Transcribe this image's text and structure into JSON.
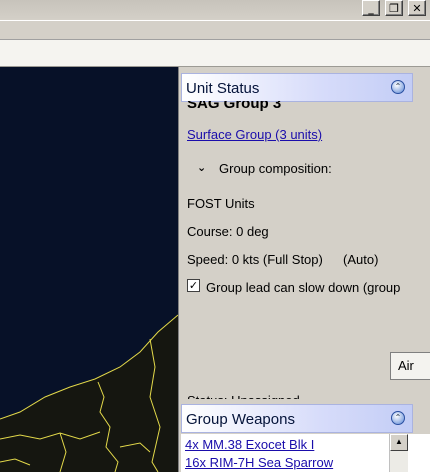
{
  "window": {
    "minimize_glyph": "_",
    "maximize_glyph": "❐",
    "close_glyph": "✕"
  },
  "unit_status": {
    "header": "Unit Status",
    "group_name": "SAG Group 3",
    "group_link": "Surface Group (3 units)",
    "composition_label": "Group composition:",
    "fost_units": "FOST Units",
    "course": "Course: 0 deg",
    "speed": "Speed: 0 kts (Full Stop)",
    "speed_mode": "(Auto)",
    "checkbox_label": "Group lead can slow down (group",
    "checkbox_checked": true,
    "air_button": "Air",
    "partial_text": "Status: Unassigned"
  },
  "group_weapons": {
    "header": "Group Weapons",
    "items": [
      "4x MM.38 Exocet Blk I",
      "16x RIM-7H Sea Sparrow"
    ]
  },
  "colors": {
    "map_sea": "#071128",
    "coastline": "#e3d94a",
    "panel_bg": "#d4d0c8",
    "link": "#1a0dab"
  }
}
